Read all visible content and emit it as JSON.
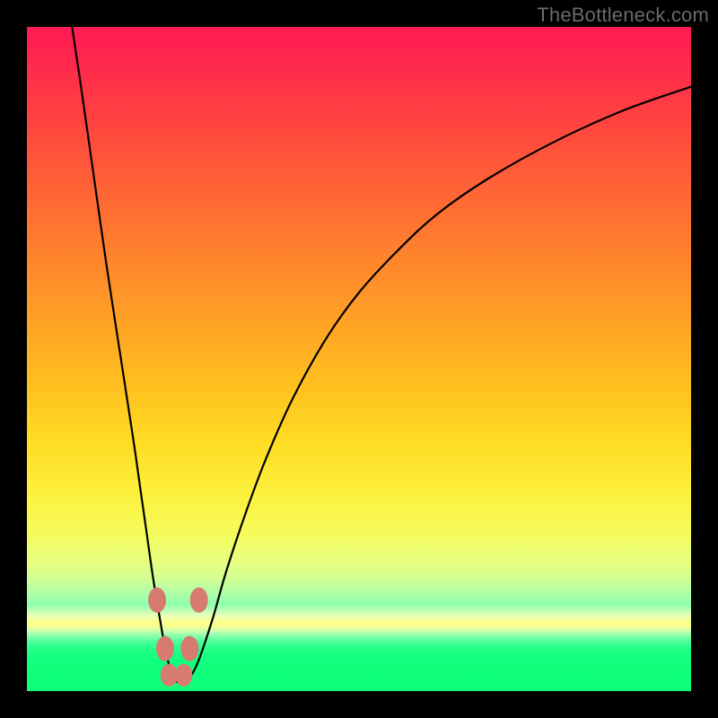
{
  "watermark": "TheBottleneck.com",
  "colors": {
    "frame_bg": "#000000",
    "curve": "#000000",
    "bead": "#d77b71",
    "gradient_top": "#ff1b53",
    "gradient_bottom": "#0dff78"
  },
  "chart_data": {
    "type": "line",
    "title": "",
    "xlabel": "",
    "ylabel": "",
    "xlim": [
      0,
      100
    ],
    "ylim": [
      0,
      100
    ],
    "series": [
      {
        "name": "bottleneck-curve",
        "x": [
          6.8,
          8,
          10,
          12,
          14,
          16,
          17,
          18,
          19,
          20,
          20.8,
          21.6,
          22.4,
          23.2,
          24,
          25,
          26,
          28,
          30,
          33,
          36,
          40,
          45,
          50,
          56,
          62,
          70,
          80,
          90,
          100
        ],
        "y": [
          100,
          92,
          78,
          64,
          51,
          38,
          31,
          24,
          17,
          11,
          6.5,
          3.2,
          1.6,
          1.2,
          1.6,
          2.8,
          5,
          11,
          18,
          27,
          35,
          44,
          53,
          60,
          66.5,
          72,
          77.5,
          83,
          87.5,
          91
        ]
      }
    ],
    "markers": [
      {
        "x": 19.6,
        "y": 13.7,
        "rx": 1.35,
        "ry": 1.9
      },
      {
        "x": 20.8,
        "y": 6.4,
        "rx": 1.35,
        "ry": 1.9
      },
      {
        "x": 21.4,
        "y": 2.4,
        "rx": 1.3,
        "ry": 1.7
      },
      {
        "x": 23.6,
        "y": 2.4,
        "rx": 1.3,
        "ry": 1.7
      },
      {
        "x": 24.5,
        "y": 6.4,
        "rx": 1.35,
        "ry": 1.9
      },
      {
        "x": 25.9,
        "y": 13.7,
        "rx": 1.35,
        "ry": 1.9
      }
    ]
  }
}
